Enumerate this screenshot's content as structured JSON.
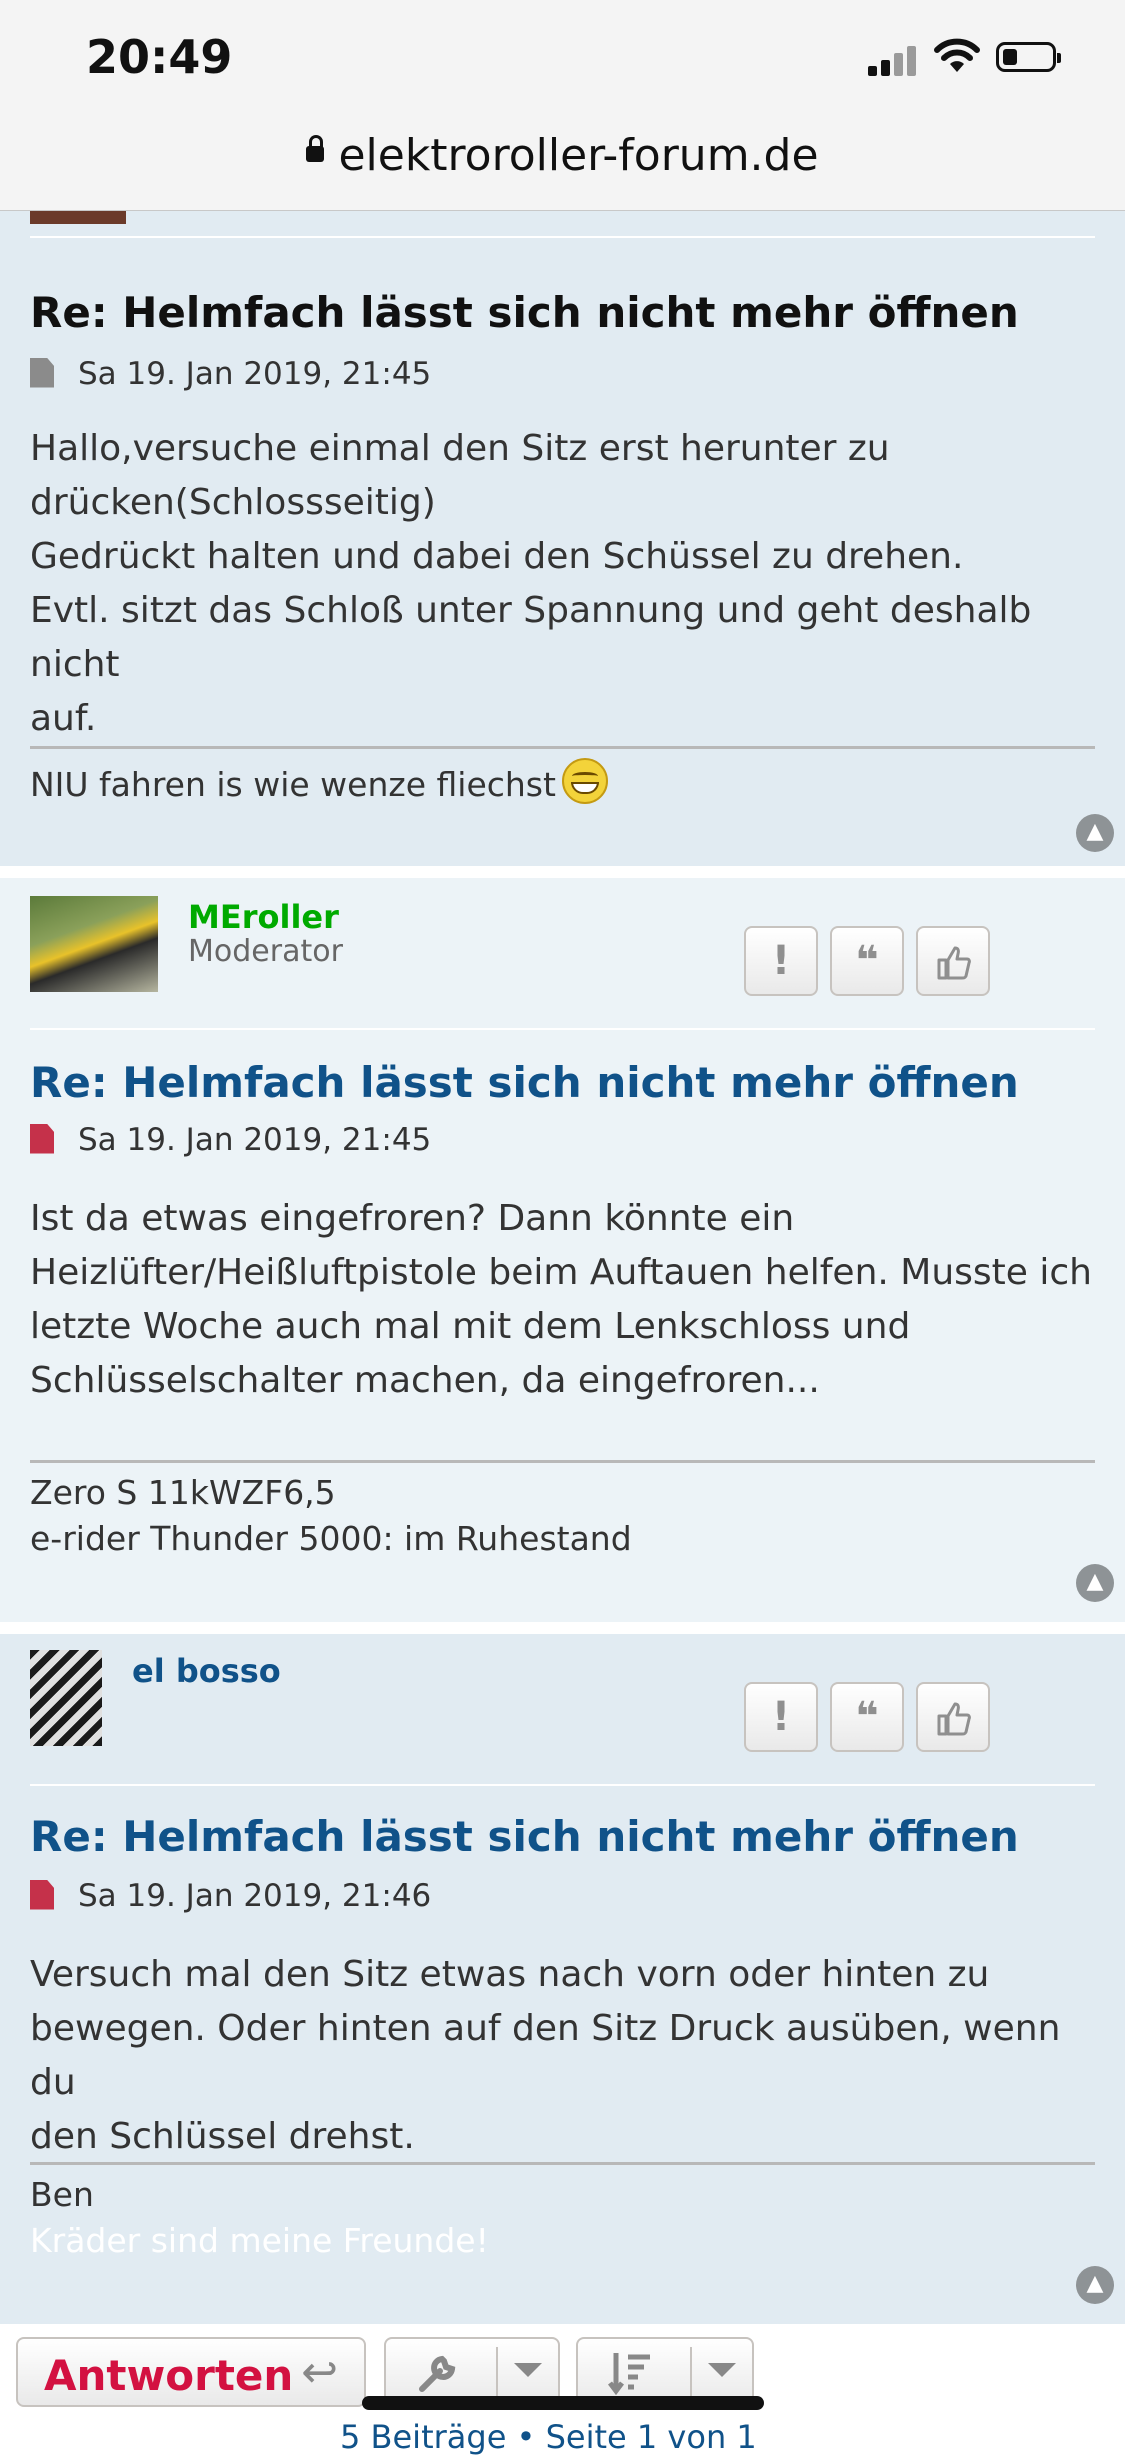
{
  "status_bar": {
    "time": "20:49"
  },
  "browser": {
    "domain": "elektroroller-forum.de"
  },
  "posts": [
    {
      "title": "Re: Helmfach lässt sich nicht mehr öffnen",
      "date": "Sa 19. Jan 2019, 21:45",
      "content": [
        "Hallo,versuche einmal den Sitz erst herunter zu",
        "drücken(Schlossseitig)",
        "Gedrückt halten und dabei den Schüssel zu drehen.",
        "Evtl. sitzt das Schloß unter Spannung und geht deshalb nicht",
        "auf."
      ],
      "signature": "NIU fahren is wie wenze fliechst"
    },
    {
      "author": "MEroller",
      "rank": "Moderator",
      "title": "Re: Helmfach lässt sich nicht mehr öffnen",
      "date": "Sa 19. Jan 2019, 21:45",
      "content": [
        "Ist da etwas eingefroren? Dann könnte ein",
        "Heizlüfter/Heißluftpistole beim Auftauen helfen. Musste ich",
        "letzte Woche auch mal mit dem Lenkschloss und",
        "Schlüsselschalter machen, da eingefroren..."
      ],
      "signature": [
        "Zero S 11kWZF6,5",
        "e-rider Thunder 5000: im Ruhestand"
      ],
      "author_color": "#00aa00"
    },
    {
      "author": "el bosso",
      "title": "Re: Helmfach lässt sich nicht mehr öffnen",
      "date": "Sa 19. Jan 2019, 21:46",
      "content": [
        "Versuch mal den Sitz etwas nach vorn oder hinten zu",
        "bewegen. Oder hinten auf den Sitz Druck ausüben, wenn du",
        "den Schlüssel drehst."
      ],
      "signature": [
        "Ben",
        "Kräder sind meine Freunde!"
      ],
      "author_color": "#105289"
    }
  ],
  "post_buttons": {
    "report": "!",
    "quote": "❝",
    "like": "👍"
  },
  "bottom_bar": {
    "reply_label": "Antworten"
  },
  "peek_text": "5 Beiträge • Seite 1 von 1",
  "colors": {
    "accent_red": "#d31141",
    "link_blue": "#105289",
    "post_bg_dark": "#e1ebf2",
    "post_bg_light": "#ecf3f7"
  },
  "icons": [
    "lock-icon",
    "document-icon",
    "report-icon",
    "quote-icon",
    "thumbs-up-icon",
    "back-to-top-icon",
    "reply-arrow-icon",
    "wrench-icon",
    "sort-icon",
    "caret-down-icon",
    "smiley-icon"
  ]
}
